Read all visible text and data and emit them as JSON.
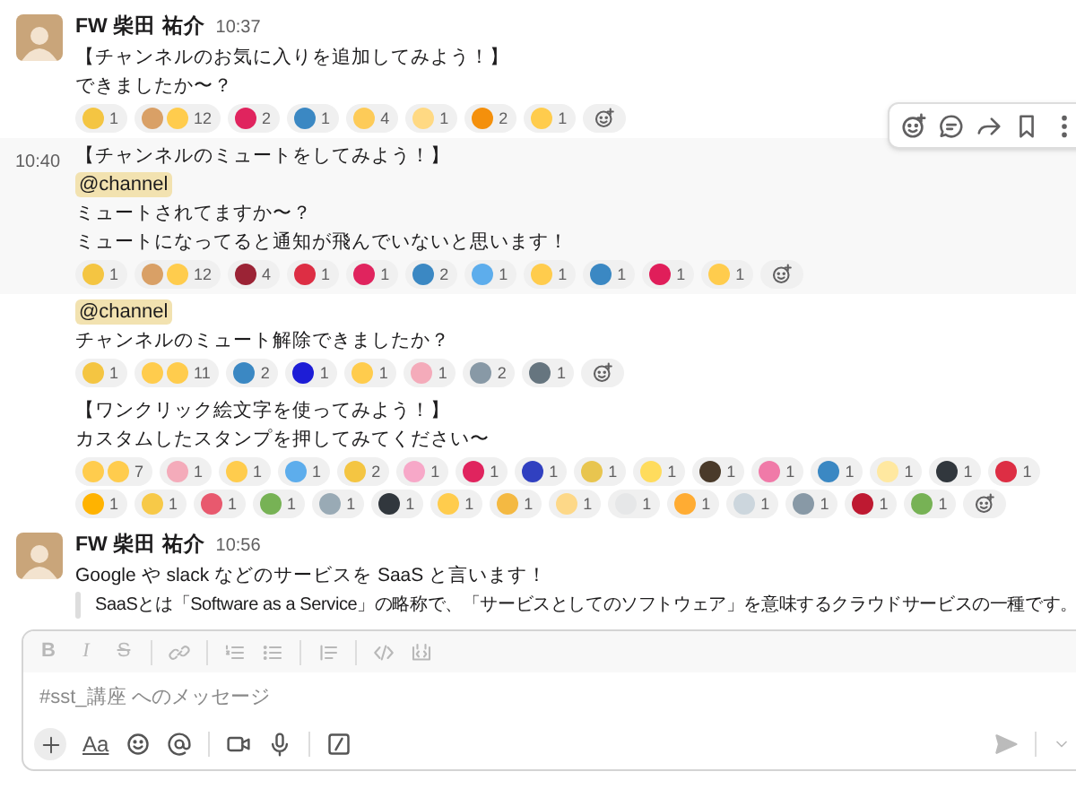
{
  "messages": [
    {
      "kind": "full",
      "author": "FW 柴田 祐介",
      "time": "10:37",
      "highlighted": false,
      "blocks": [
        {
          "kind": "text",
          "text": "【チャンネルのお気に入りを追加してみよう！】"
        },
        {
          "kind": "text",
          "text": "できましたか〜？"
        }
      ],
      "reactions": [
        {
          "kind": "single",
          "color": "#f4c542",
          "count": "1"
        },
        {
          "kind": "pair",
          "color": "#d9a066",
          "count": "12"
        },
        {
          "kind": "single",
          "color": "#e0245e",
          "count": "2"
        },
        {
          "kind": "single",
          "color": "#3b88c3",
          "count": "1"
        },
        {
          "kind": "single",
          "color": "#fdcb58",
          "count": "4"
        },
        {
          "kind": "single",
          "color": "#ffd983",
          "count": "1"
        },
        {
          "kind": "single",
          "color": "#f4900c",
          "count": "2"
        },
        {
          "kind": "single",
          "color": "#ffcc4d",
          "count": "1"
        }
      ]
    },
    {
      "kind": "continuation",
      "time": "10:40",
      "highlighted": true,
      "blocks": [
        {
          "kind": "text",
          "text": "【チャンネルのミュートをしてみよう！】"
        },
        {
          "kind": "mention",
          "text": "@channel"
        },
        {
          "kind": "text",
          "text": "ミュートされてますか〜？"
        },
        {
          "kind": "text",
          "text": "ミュートになってると通知が飛んでいないと思います！"
        }
      ],
      "reactions": [
        {
          "kind": "single",
          "color": "#f4c542",
          "count": "1"
        },
        {
          "kind": "pair",
          "color": "#d9a066",
          "count": "12"
        },
        {
          "kind": "single",
          "color": "#9b2335",
          "count": "4"
        },
        {
          "kind": "single",
          "color": "#dd2e44",
          "count": "1"
        },
        {
          "kind": "single",
          "color": "#e0245e",
          "count": "1"
        },
        {
          "kind": "single",
          "color": "#3b88c3",
          "count": "2"
        },
        {
          "kind": "single",
          "color": "#5dadec",
          "count": "1"
        },
        {
          "kind": "single",
          "color": "#ffcc4d",
          "count": "1"
        },
        {
          "kind": "single",
          "color": "#3b88c3",
          "count": "1"
        },
        {
          "kind": "single",
          "color": "#e01e5a",
          "count": "1"
        },
        {
          "kind": "single",
          "color": "#ffcc4d",
          "count": "1"
        }
      ]
    },
    {
      "kind": "continuation",
      "highlighted": false,
      "blocks": [
        {
          "kind": "mention",
          "text": "@channel"
        },
        {
          "kind": "text",
          "text": "チャンネルのミュート解除できましたか？"
        }
      ],
      "reactions": [
        {
          "kind": "single",
          "color": "#f4c542",
          "count": "1"
        },
        {
          "kind": "pair",
          "color": "#ffcc4d",
          "count": "11"
        },
        {
          "kind": "single",
          "color": "#3b88c3",
          "count": "2"
        },
        {
          "kind": "single",
          "color": "#1d1dd6",
          "count": "1"
        },
        {
          "kind": "single",
          "color": "#ffcc4d",
          "count": "1"
        },
        {
          "kind": "single",
          "color": "#f4abba",
          "count": "1"
        },
        {
          "kind": "single",
          "color": "#8899a6",
          "count": "2"
        },
        {
          "kind": "single",
          "color": "#66757f",
          "count": "1"
        }
      ]
    },
    {
      "kind": "continuation",
      "highlighted": false,
      "blocks": [
        {
          "kind": "text",
          "text": "【ワンクリック絵文字を使ってみよう！】"
        },
        {
          "kind": "text",
          "text": "カスタムしたスタンプを押してみてください〜"
        }
      ],
      "reactions": [
        {
          "kind": "pair",
          "color": "#ffcc4d",
          "count": "7"
        },
        {
          "kind": "single",
          "color": "#f4abba",
          "count": "1"
        },
        {
          "kind": "single",
          "color": "#ffcc4d",
          "count": "1"
        },
        {
          "kind": "single",
          "color": "#5dadec",
          "count": "1"
        },
        {
          "kind": "single",
          "color": "#f4c542",
          "count": "2"
        },
        {
          "kind": "single",
          "color": "#f7a8c8",
          "count": "1"
        },
        {
          "kind": "single",
          "color": "#e0245e",
          "count": "1"
        },
        {
          "kind": "single",
          "color": "#3040c0",
          "count": "1"
        },
        {
          "kind": "single",
          "color": "#e8c54f",
          "count": "1"
        },
        {
          "kind": "single",
          "color": "#ffdc5d",
          "count": "1"
        },
        {
          "kind": "single",
          "color": "#4a3a2a",
          "count": "1"
        },
        {
          "kind": "single",
          "color": "#f07aa8",
          "count": "1"
        },
        {
          "kind": "single",
          "color": "#3b88c3",
          "count": "1"
        },
        {
          "kind": "single",
          "color": "#ffe8a0",
          "count": "1"
        },
        {
          "kind": "single",
          "color": "#31373d",
          "count": "1"
        },
        {
          "kind": "single",
          "color": "#dd2e44",
          "count": "1"
        },
        {
          "kind": "single",
          "color": "#ffb300",
          "count": "1"
        },
        {
          "kind": "single",
          "color": "#f7c948",
          "count": "1"
        },
        {
          "kind": "single",
          "color": "#e8596e",
          "count": "1"
        },
        {
          "kind": "single",
          "color": "#77b255",
          "count": "1"
        },
        {
          "kind": "single",
          "color": "#99aab5",
          "count": "1"
        },
        {
          "kind": "single",
          "color": "#31373d",
          "count": "1"
        },
        {
          "kind": "single",
          "color": "#ffcc4d",
          "count": "1"
        },
        {
          "kind": "single",
          "color": "#f4b942",
          "count": "1"
        },
        {
          "kind": "single",
          "color": "#fdd888",
          "count": "1"
        },
        {
          "kind": "single",
          "color": "#e6e7e8",
          "count": "1"
        },
        {
          "kind": "single",
          "color": "#ffac33",
          "count": "1"
        },
        {
          "kind": "single",
          "color": "#ccd6dd",
          "count": "1"
        },
        {
          "kind": "single",
          "color": "#8899a6",
          "count": "1"
        },
        {
          "kind": "single",
          "color": "#be1931",
          "count": "1"
        },
        {
          "kind": "single",
          "color": "#77b255",
          "count": "1"
        }
      ]
    },
    {
      "kind": "full",
      "author": "FW 柴田 祐介",
      "time": "10:56",
      "highlighted": false,
      "blocks": [
        {
          "kind": "text",
          "text": "Google や slack などのサービスを SaaS と言います！"
        },
        {
          "kind": "quote",
          "text": "SaaSとは「Software as a Service」の略称で、「サービスとしてのソフトウェア」を意味するクラウドサービスの一種です。"
        }
      ]
    }
  ],
  "composer": {
    "bold_label": "B",
    "italic_label": "I",
    "strike_label": "S",
    "placeholder": "#sst_講座 へのメッセージ",
    "format_label": "Aa"
  }
}
